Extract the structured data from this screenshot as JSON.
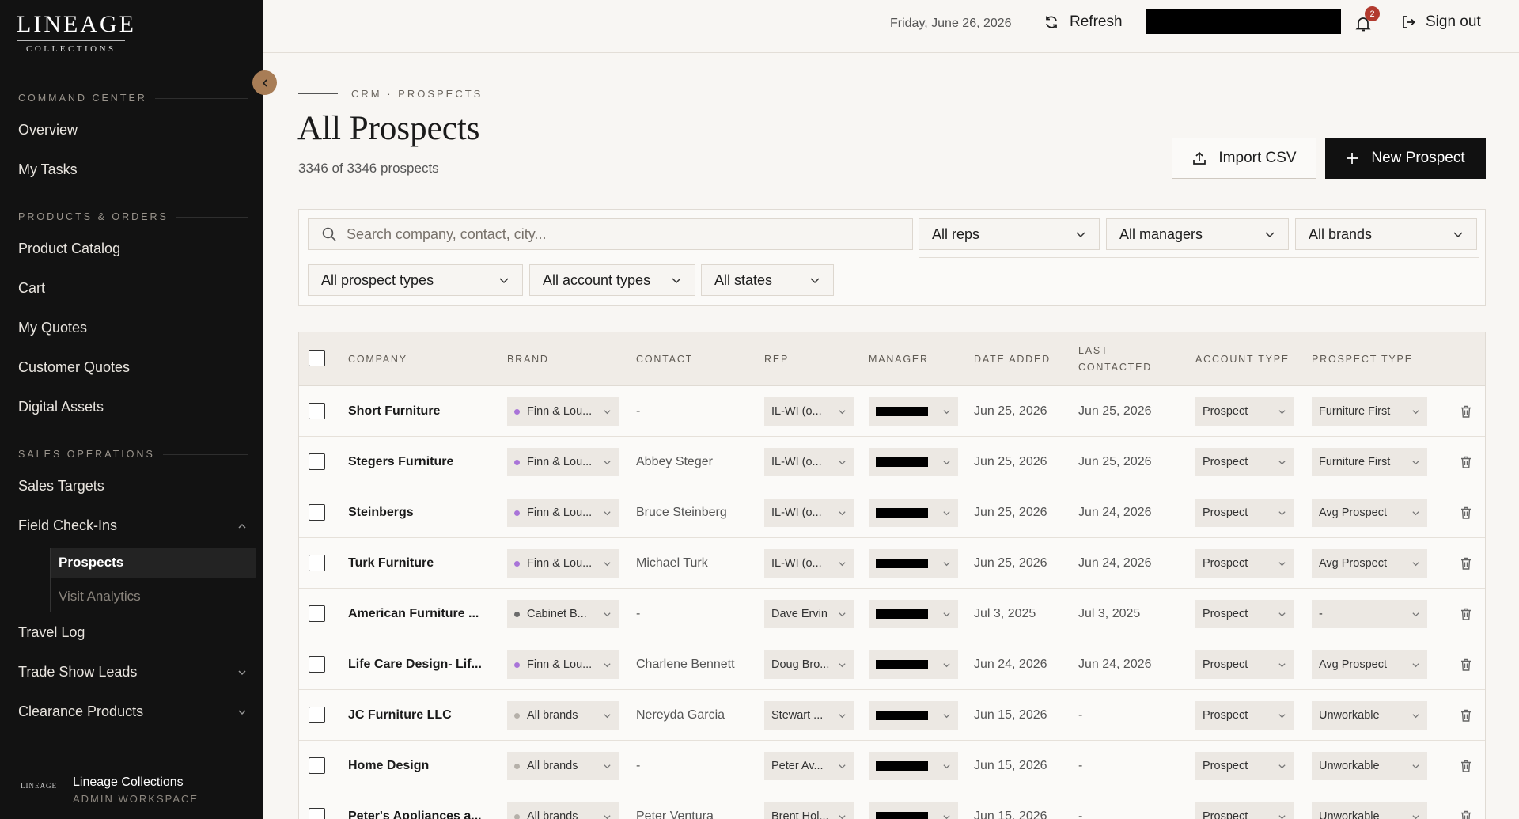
{
  "sidebar": {
    "brand_main": "LINEAGE",
    "brand_sub": "COLLECTIONS",
    "sections": {
      "command": "COMMAND CENTER",
      "products": "PRODUCTS & ORDERS",
      "sales": "SALES OPERATIONS"
    },
    "items": {
      "overview": "Overview",
      "tasks": "My Tasks",
      "catalog": "Product Catalog",
      "cart": "Cart",
      "quotes": "My Quotes",
      "customer_quotes": "Customer Quotes",
      "assets": "Digital Assets",
      "targets": "Sales Targets",
      "checkins": "Field Check-Ins",
      "prospects": "Prospects",
      "analytics": "Visit Analytics",
      "travel": "Travel Log",
      "tradeshow": "Trade Show Leads",
      "clearance": "Clearance Products"
    },
    "footer": {
      "logo": "LINEAGE",
      "name": "Lineage Collections",
      "role": "ADMIN WORKSPACE"
    }
  },
  "header": {
    "date": "Friday, June 26, 2026",
    "refresh": "Refresh",
    "notifications": "2",
    "signout": "Sign out"
  },
  "page": {
    "breadcrumb": "CRM · PROSPECTS",
    "title": "All Prospects",
    "count": "3346 of 3346 prospects",
    "import": "Import CSV",
    "new": "New Prospect"
  },
  "filters": {
    "search_placeholder": "Search company, contact, city...",
    "reps": "All reps",
    "managers": "All managers",
    "brands": "All brands",
    "prospect_types": "All prospect types",
    "account_types": "All account types",
    "states": "All states"
  },
  "table": {
    "columns": {
      "company": "COMPANY",
      "brand": "BRAND",
      "contact": "CONTACT",
      "rep": "REP",
      "manager": "MANAGER",
      "date_added": "DATE ADDED",
      "last_contacted_1": "LAST",
      "last_contacted_2": "CONTACTED",
      "account_type": "ACCOUNT TYPE",
      "prospect_type": "PROSPECT TYPE"
    },
    "rows": [
      {
        "company": "Short Furniture",
        "brand": "Finn & Lou...",
        "brand_color": "#a974d8",
        "contact": "-",
        "rep": "IL-WI (o...",
        "added": "Jun 25, 2026",
        "last": "Jun 25, 2026",
        "account": "Prospect",
        "ptype": "Furniture First"
      },
      {
        "company": "Stegers Furniture",
        "brand": "Finn & Lou...",
        "brand_color": "#a974d8",
        "contact": "Abbey Steger",
        "rep": "IL-WI (o...",
        "added": "Jun 25, 2026",
        "last": "Jun 25, 2026",
        "account": "Prospect",
        "ptype": "Furniture First"
      },
      {
        "company": "Steinbergs",
        "brand": "Finn & Lou...",
        "brand_color": "#a974d8",
        "contact": "Bruce Steinberg",
        "rep": "IL-WI (o...",
        "added": "Jun 25, 2026",
        "last": "Jun 24, 2026",
        "account": "Prospect",
        "ptype": "Avg Prospect"
      },
      {
        "company": "Turk Furniture",
        "brand": "Finn & Lou...",
        "brand_color": "#a974d8",
        "contact": "Michael Turk",
        "rep": "IL-WI (o...",
        "added": "Jun 25, 2026",
        "last": "Jun 24, 2026",
        "account": "Prospect",
        "ptype": "Avg Prospect"
      },
      {
        "company": "American Furniture ...",
        "brand": "Cabinet B...",
        "brand_color": "#6b6b6b",
        "contact": "-",
        "rep": "Dave Ervin",
        "added": "Jul 3, 2025",
        "last": "Jul 3, 2025",
        "account": "Prospect",
        "ptype": "-"
      },
      {
        "company": "Life Care Design- Lif...",
        "brand": "Finn & Lou...",
        "brand_color": "#a974d8",
        "contact": "Charlene Bennett",
        "rep": "Doug Bro...",
        "added": "Jun 24, 2026",
        "last": "Jun 24, 2026",
        "account": "Prospect",
        "ptype": "Avg Prospect"
      },
      {
        "company": "JC Furniture LLC",
        "brand": "All brands",
        "brand_color": "#b5b0a9",
        "contact": "Nereyda Garcia",
        "rep": "Stewart ...",
        "added": "Jun 15, 2026",
        "last": "-",
        "account": "Prospect",
        "ptype": "Unworkable"
      },
      {
        "company": "Home Design",
        "brand": "All brands",
        "brand_color": "#b5b0a9",
        "contact": "-",
        "rep": "Peter Av...",
        "added": "Jun 15, 2026",
        "last": "-",
        "account": "Prospect",
        "ptype": "Unworkable"
      },
      {
        "company": "Peter's Appliances a...",
        "brand": "All brands",
        "brand_color": "#b5b0a9",
        "contact": "Peter Ventura",
        "rep": "Brent Hol...",
        "added": "Jun 15, 2026",
        "last": "-",
        "account": "Prospect",
        "ptype": "Unworkable"
      }
    ]
  }
}
